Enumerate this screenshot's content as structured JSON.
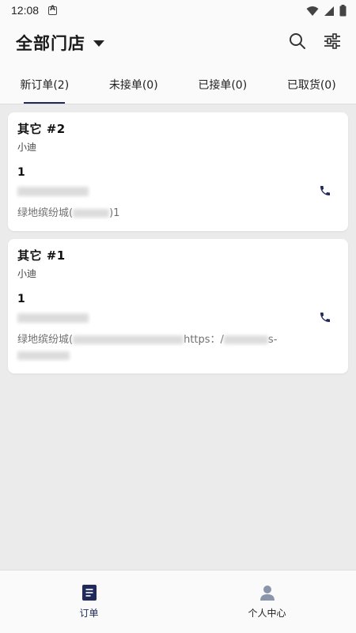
{
  "status_bar": {
    "time": "12:08"
  },
  "header": {
    "store_selector": "全部门店"
  },
  "tabs": [
    {
      "label": "新订单(2)",
      "active": true
    },
    {
      "label": "未接单(0)",
      "active": false
    },
    {
      "label": "已接单(0)",
      "active": false
    },
    {
      "label": "已取货(0)",
      "active": false
    }
  ],
  "orders": [
    {
      "title": "其它 #2",
      "user": "小迪",
      "count": "1",
      "address_prefix": "绿地缤纷城(",
      "address_suffix": ")1"
    },
    {
      "title": "其它 #1",
      "user": "小迪",
      "count": "1",
      "address_prefix": "绿地缤纷城(",
      "address_mid": "https：/",
      "address_suffix": "s-"
    }
  ],
  "bottom_nav": [
    {
      "label": "订单",
      "icon": "order-list-icon",
      "active": true
    },
    {
      "label": "个人中心",
      "icon": "person-icon",
      "active": false
    }
  ],
  "colors": {
    "accent": "#1f2a5a",
    "background": "#ebebeb",
    "card": "#ffffff"
  }
}
